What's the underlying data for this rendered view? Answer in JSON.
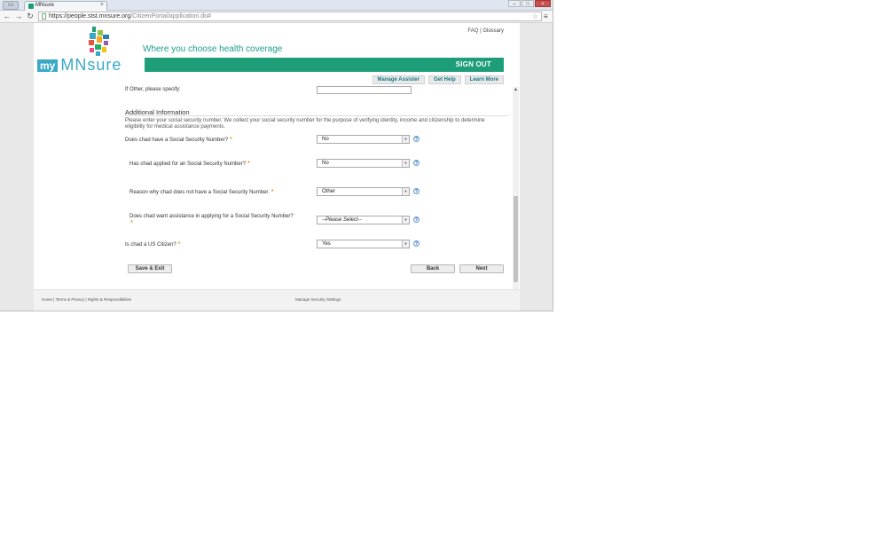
{
  "browser": {
    "tab_title": "MNsure",
    "url_host": "https://people.stst.mnsure.org",
    "url_path": "/CitizenPortal/application.do#"
  },
  "header": {
    "tagline": "Where you choose health coverage",
    "faq_link": "FAQ",
    "separator": "|",
    "glossary_link": "Glossary",
    "sign_out": "SIGN OUT",
    "logo_my": "my",
    "logo_mnsure": "MNsure",
    "subnav": [
      "Manage Assister",
      "Get Help",
      "Learn More"
    ]
  },
  "form": {
    "other_specify_label": "If Other, please specify:",
    "section_title": "Additional Information",
    "section_desc": "Please enter your social security number. We collect your social security number for the purpose of verifying identity, income and citizenship to determine eligibility for medical assistance payments.",
    "required_marker": "*",
    "help_glyph": "?",
    "questions": [
      {
        "label": "Does chad have a Social Security Number?",
        "value": "No"
      },
      {
        "label": "Has chad applied for an Social Security Number?",
        "value": "No"
      },
      {
        "label": "Reason why chad does not have a Social Security Number.",
        "value": "Other"
      },
      {
        "label": "Does chad want assistance in applying for a Social Security Number?",
        "value": "--Please Select--"
      },
      {
        "label": "Is chad a US Citizen?",
        "value": "Yes"
      }
    ],
    "save_exit": "Save & Exit",
    "back": "Back",
    "next": "Next"
  },
  "footer": {
    "links": "Home | Terms & Privacy | Rights & Responsibilities",
    "center": "Manage Security Settings"
  },
  "colors": {
    "brand_green": "#1e9e78",
    "brand_teal": "#3aa8c7",
    "required_orange": "#e6a020"
  }
}
